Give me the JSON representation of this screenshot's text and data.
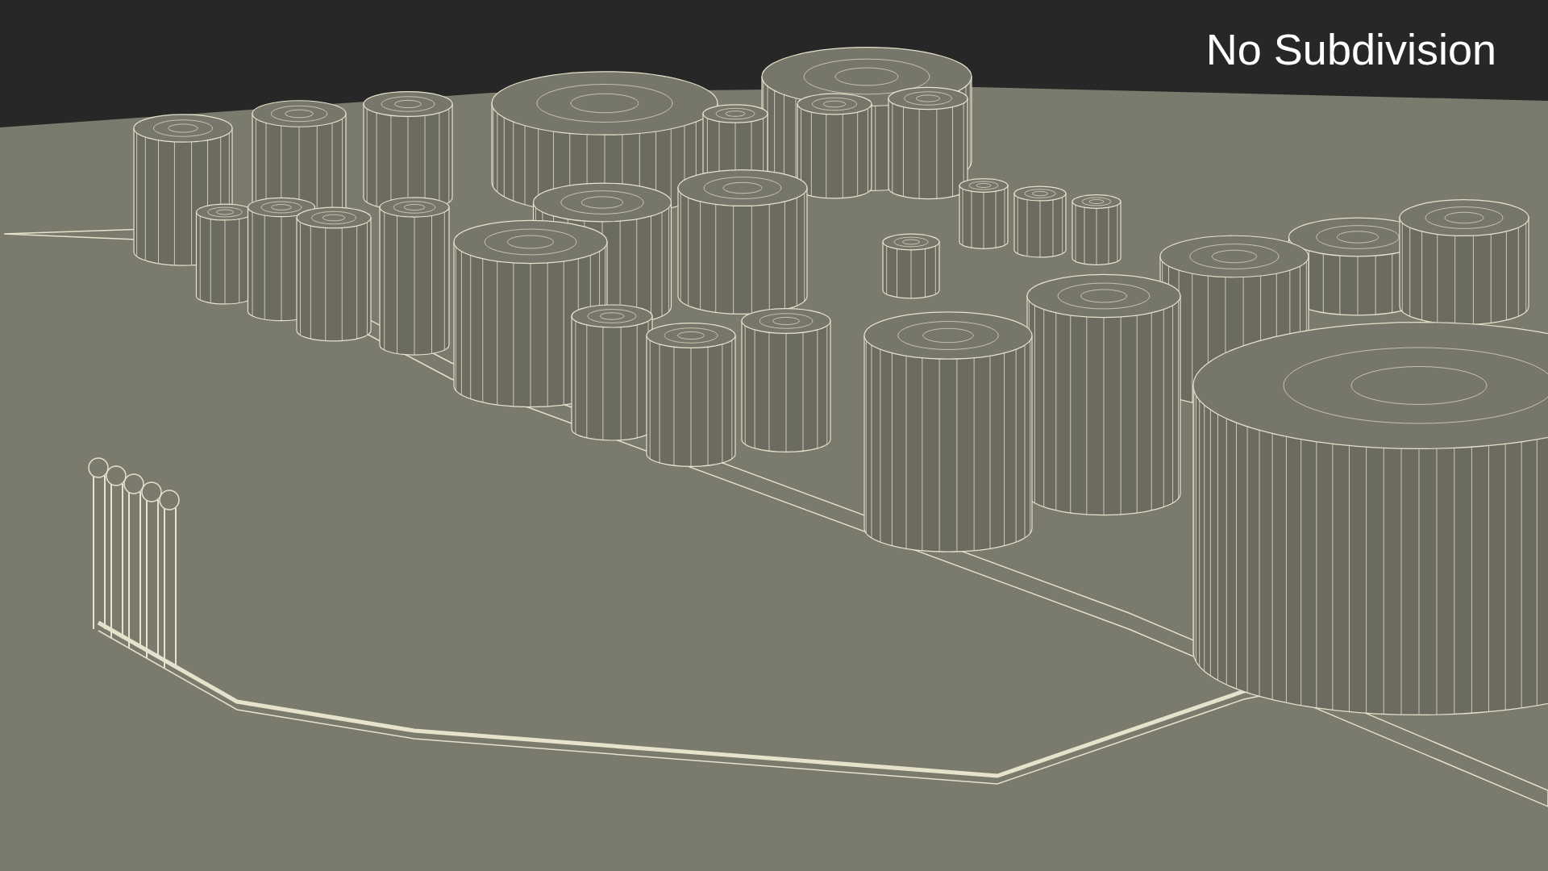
{
  "caption": {
    "text": "No Subdivision"
  }
}
